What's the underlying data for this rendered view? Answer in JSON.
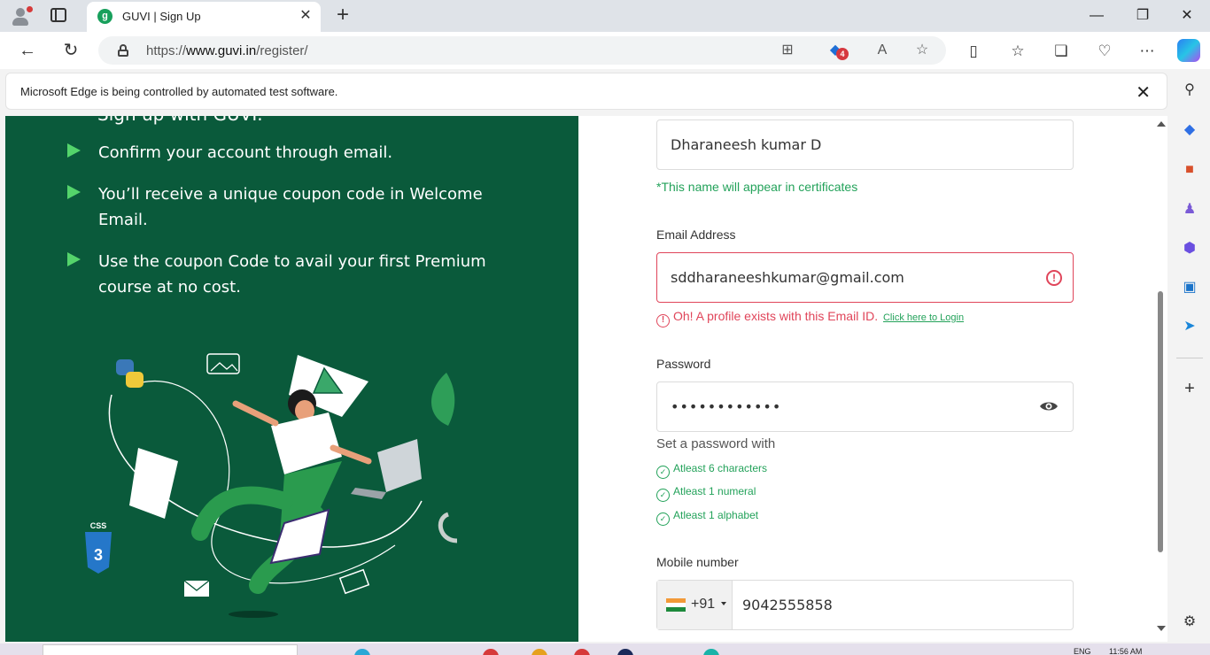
{
  "browser": {
    "tab_title": "GUVI | Sign Up",
    "favicon_letter": "g",
    "url_prefix": "https://",
    "url_host": "www.guvi.in",
    "url_path": "/register/",
    "extension_badge": "4",
    "infobar_message": "Microsoft Edge is being controlled by automated test software."
  },
  "left_panel": {
    "partial_text": "Sign up with GUVI.",
    "bullets": [
      "Confirm your account through email.",
      "You’ll receive a unique coupon code in Welcome Email.",
      "Use the coupon Code to avail your first Premium course at no cost."
    ],
    "css_badge": "CSS"
  },
  "form": {
    "name_value": "Dharaneesh kumar D",
    "name_note": "*This name will appear in certificates",
    "email_label": "Email Address",
    "email_value": "sddharaneeshkumar@gmail.com",
    "email_error": "Oh! A profile exists with this Email ID.",
    "email_login_link": "Click here to Login",
    "password_label": "Password",
    "password_value": "••••••••••••",
    "password_hint": "Set a password with",
    "password_rules": [
      "Atleast 6 characters",
      "Atleast 1 numeral",
      "Atleast 1 alphabet"
    ],
    "mobile_label": "Mobile number",
    "country_code": "+91",
    "mobile_value": "9042555858"
  },
  "taskbar": {
    "lang": "ENG",
    "time": "11:56 AM"
  },
  "colors": {
    "panel_green": "#0a5a3b",
    "accent_green": "#23a25a",
    "error_red": "#e0455a"
  }
}
